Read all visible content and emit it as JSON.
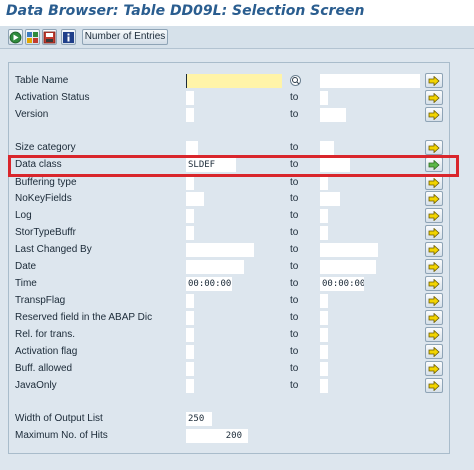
{
  "window": {
    "title": "Data Browser: Table DD09L: Selection Screen"
  },
  "toolbar": {
    "buttons": [
      {
        "name": "execute-button",
        "icon": "execute-icon"
      },
      {
        "name": "get-variant-button",
        "icon": "get-variant-icon"
      },
      {
        "name": "save-variant-button",
        "icon": "save-icon"
      },
      {
        "name": "info-button",
        "icon": "info-icon"
      }
    ],
    "number_of_entries_label": "Number of Entries"
  },
  "form": {
    "to_label": "to",
    "rows": [
      {
        "label": "Table Name",
        "low": "",
        "high": ""
      },
      {
        "label": "Activation Status",
        "low": "",
        "high": ""
      },
      {
        "label": "Version",
        "low": "",
        "high": ""
      },
      {
        "label": "Size category",
        "low": "",
        "high": ""
      },
      {
        "label": "Data class",
        "low": "SLDEF",
        "high": ""
      },
      {
        "label": "Buffering type",
        "low": "",
        "high": ""
      },
      {
        "label": "NoKeyFields",
        "low": "",
        "high": ""
      },
      {
        "label": "Log",
        "low": "",
        "high": ""
      },
      {
        "label": "StorTypeBuffr",
        "low": "",
        "high": ""
      },
      {
        "label": "Last Changed By",
        "low": "",
        "high": ""
      },
      {
        "label": "Date",
        "low": "",
        "high": ""
      },
      {
        "label": "Time",
        "low": "00:00:00",
        "high": "00:00:00"
      },
      {
        "label": "TranspFlag",
        "low": "",
        "high": ""
      },
      {
        "label": "Reserved field in the ABAP Dic",
        "low": "",
        "high": ""
      },
      {
        "label": "Rel. for trans.",
        "low": "",
        "high": ""
      },
      {
        "label": "Activation flag",
        "low": "",
        "high": ""
      },
      {
        "label": "Buff. allowed",
        "low": "",
        "high": ""
      },
      {
        "label": "JavaOnly",
        "low": "",
        "high": ""
      }
    ],
    "output": {
      "width_label": "Width of Output List",
      "width_value": "250",
      "max_hits_label": "Maximum No. of Hits",
      "max_hits_value": "200"
    }
  },
  "colors": {
    "background": "#dde6ee",
    "title": "#2a5d8f",
    "required_field": "#fff4a8",
    "highlight": "#d9262c",
    "arrow": "#f2d400"
  }
}
